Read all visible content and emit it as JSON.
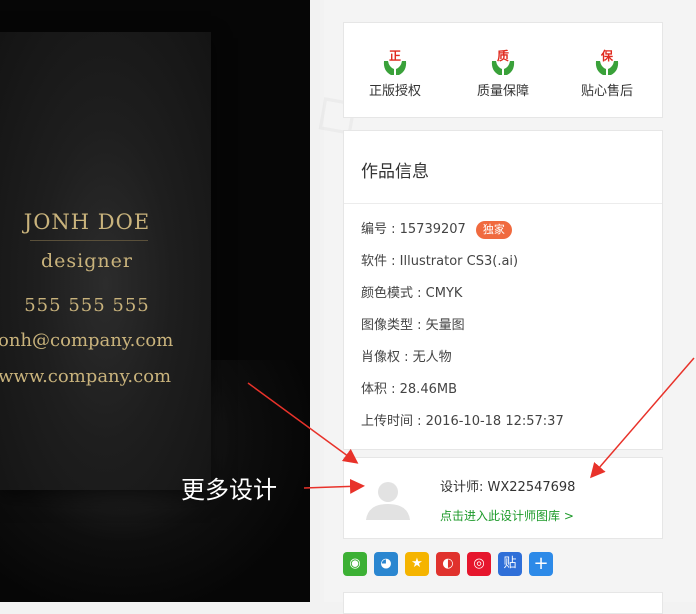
{
  "card": {
    "name": "JONH DOE",
    "title": "designer",
    "phone": "555 555 555",
    "email": "onh@company.com",
    "website": "www.company.com"
  },
  "annotation": {
    "more_designs": "更多设计"
  },
  "guarantees": [
    {
      "label": "正版授权",
      "char": "正",
      "icon": "hands-icon"
    },
    {
      "label": "质量保障",
      "char": "质",
      "icon": "hands-icon"
    },
    {
      "label": "贴心售后",
      "char": "保",
      "icon": "hands-icon"
    }
  ],
  "info": {
    "title": "作品信息",
    "id": "编号 : 15739207",
    "badge": "独家",
    "software": "软件 : Illustrator CS3(.ai)",
    "color_mode": "颜色模式 : CMYK",
    "image_type": "图像类型 : 矢量图",
    "portrait": "肖像权 : 无人物",
    "size": "体积 : 28.46MB",
    "upload_time": "上传时间 : 2016-10-18 12:57:37"
  },
  "designer": {
    "label": "设计师:  WX22547698",
    "link": "点击进入此设计师图库 >"
  },
  "share": [
    {
      "name": "wechat-icon",
      "color": "#3cb034",
      "glyph": "◉"
    },
    {
      "name": "qq-icon",
      "color": "#2a86d0",
      "glyph": "◕"
    },
    {
      "name": "qzone-icon",
      "color": "#f5b400",
      "glyph": "★"
    },
    {
      "name": "tencent-weibo-icon",
      "color": "#e0322d",
      "glyph": "◐"
    },
    {
      "name": "sina-weibo-icon",
      "color": "#e6162d",
      "glyph": "◎"
    },
    {
      "name": "tieba-icon",
      "color": "#2f6fd8",
      "glyph": "贴"
    },
    {
      "name": "more-share-icon",
      "color": "#2d8ae8",
      "glyph": "+"
    }
  ],
  "colors": {
    "accent_green": "#1d9a2a",
    "badge": "#f06a3f",
    "gold_text": "#c9b37c"
  }
}
